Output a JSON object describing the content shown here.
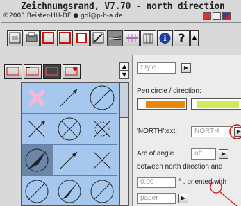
{
  "window": {
    "title": "Zeichnungsrand, V7.70 - north direction",
    "copyright": "©2003 Beister-HH-DE ● gdl@p-b-a.de"
  },
  "toolbar": {
    "help_glyph": "?",
    "info_glyph": "i",
    "scroll_glyph": "▲"
  },
  "panel": {
    "style_placeholder": "Style",
    "pen_label": "Pen circle  /  direction:",
    "north_label": "'NORTH'text:",
    "north_value": "NORTH",
    "arc_label": "Arc of angle",
    "arc_value": "off",
    "between_label": "between north direction and",
    "angle_value": "0,00",
    "oriented_label": "° , oriented with",
    "paper_value": "paper",
    "pen_colors": [
      "#e8870c",
      "#f5c84a"
    ]
  },
  "colors": {
    "grid_bg": "#a6c8ef",
    "selected_cell": "#6c86a8",
    "accent_red": "#cc1111",
    "pink_x": "#f7b8d8"
  }
}
